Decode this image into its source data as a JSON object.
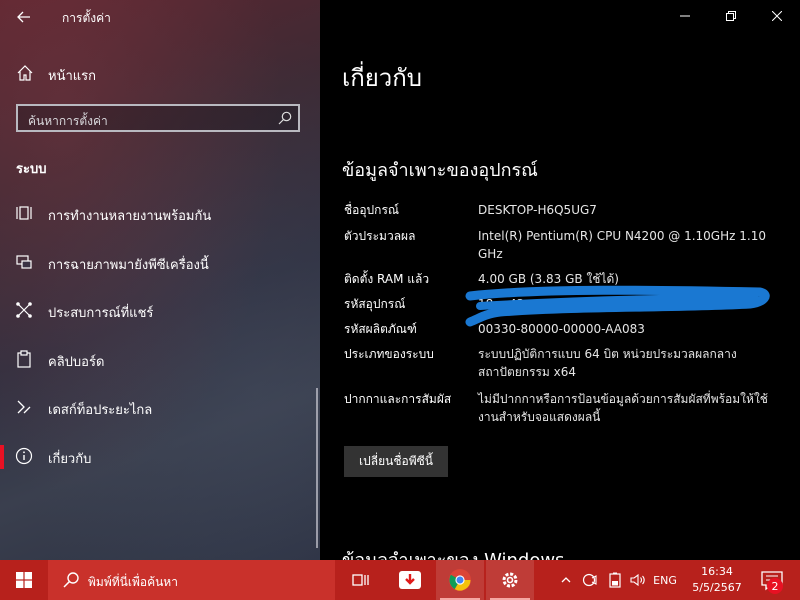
{
  "window": {
    "app_title": "การตั้งค่า"
  },
  "nav": {
    "home_label": "หน้าแรก",
    "search_placeholder": "ค้นหาการตั้งค่า",
    "section_label": "ระบบ",
    "items": [
      {
        "label": "การทำงานหลายงานพร้อมกัน",
        "icon": "multitasking-icon"
      },
      {
        "label": "การฉายภาพมายังพีซีเครื่องนี้",
        "icon": "projecting-icon"
      },
      {
        "label": "ประสบการณ์ที่แชร์",
        "icon": "shared-experiences-icon"
      },
      {
        "label": "คลิปบอร์ด",
        "icon": "clipboard-icon"
      },
      {
        "label": "เดสก์ท็อประยะไกล",
        "icon": "remote-desktop-icon"
      },
      {
        "label": "เกี่ยวกับ",
        "icon": "info-icon",
        "selected": true
      }
    ]
  },
  "content": {
    "page_title": "เกี่ยวกับ",
    "device_specs_heading": "ข้อมูลจำเพาะของอุปกรณ์",
    "specs": [
      {
        "key": "ชื่ออุปกรณ์",
        "value": "DESKTOP-H6Q5UG7"
      },
      {
        "key": "ตัวประมวลผล",
        "value": "Intel(R) Pentium(R) CPU N4200 @ 1.10GHz 1.10 GHz"
      },
      {
        "key": "ติดตั้ง RAM แล้ว",
        "value": "4.00 GB (3.83 GB ใช้ได้)"
      },
      {
        "key": "รหัสอุปกรณ์",
        "value": "18...-43..-...AB212"
      },
      {
        "key": "รหัสผลิตภัณฑ์",
        "value": "00330-80000-00000-AA083"
      },
      {
        "key": "ประเภทของระบบ",
        "value": "ระบบปฏิบัติการแบบ 64 บิต หน่วยประมวลผลกลางสถาปัตยกรรม x64"
      },
      {
        "key": "ปากกาและการสัมผัส",
        "value": "ไม่มีปากกาหรือการป้อนข้อมูลด้วยการสัมผัสที่พร้อมให้ใช้งานสำหรับจอแสดงผลนี้"
      }
    ],
    "rename_button": "เปลี่ยนชื่อพีซีนี้",
    "windows_specs_heading": "ข้อมูลจำเพาะของ Windows"
  },
  "taskbar": {
    "search_placeholder": "พิมพ์ที่นี่เพื่อค้นหา",
    "language": "ENG",
    "time": "16:34",
    "date": "5/5/2567",
    "notification_count": "2"
  },
  "colors": {
    "accent": "#e81123",
    "taskbar": "#b7211c",
    "content_bg": "#000000"
  }
}
